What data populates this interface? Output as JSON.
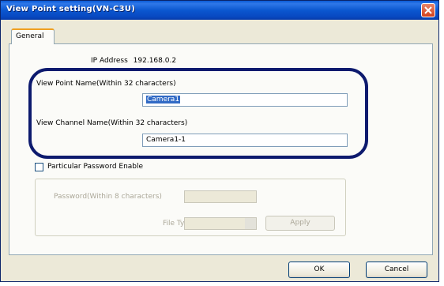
{
  "window": {
    "title": "View Point setting(VN-C3U)"
  },
  "tabs": [
    {
      "label": "General"
    }
  ],
  "general": {
    "ip_address_label": "IP Address",
    "ip_address_value": "192.168.0.2",
    "view_point_name_label": "View Point Name(Within 32 characters)",
    "view_point_name_value": "Camera1",
    "view_channel_name_label": "View Channel Name(Within 32 characters)",
    "view_channel_name_value": "Camera1-1",
    "password_enable_label": "Particular Password Enable",
    "password_enable_checked": false,
    "password_label": "Password(Within 8 characters)",
    "password_value": "",
    "file_type_label": "File Type",
    "file_type_value": "",
    "apply_label": "Apply"
  },
  "footer": {
    "ok_label": "OK",
    "cancel_label": "Cancel"
  },
  "colors": {
    "titlebar": "#0b57d0",
    "highlight_oval": "#0d1a6e",
    "selection": "#316ac5",
    "tab_accent": "#f0a022"
  }
}
